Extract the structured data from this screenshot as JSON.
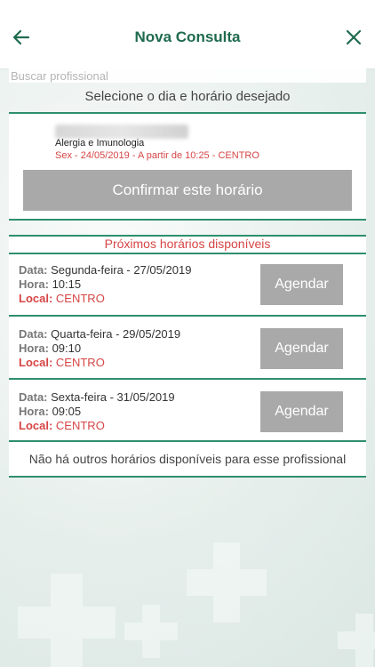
{
  "header": {
    "title": "Nova Consulta",
    "back_icon": "arrow-left-icon",
    "close_icon": "close-icon"
  },
  "search": {
    "placeholder": "Buscar profissional"
  },
  "instruction": "Selecione o dia e horário desejado",
  "selected": {
    "specialty": "Alergia e Imunologia",
    "detail": "Sex - 24/05/2019 - A partir de 10:25 - CENTRO",
    "confirm_label": "Confirmar este horário"
  },
  "next": {
    "title": "Próximos horários disponíveis",
    "date_label": "Data:",
    "time_label": "Hora:",
    "place_label": "Local:",
    "book_label": "Agendar",
    "slots": [
      {
        "date": "Segunda-feira - 27/05/2019",
        "time": "10:15",
        "place": "CENTRO"
      },
      {
        "date": "Quarta-feira - 29/05/2019",
        "time": "09:10",
        "place": "CENTRO"
      },
      {
        "date": "Sexta-feira - 31/05/2019",
        "time": "09:05",
        "place": "CENTRO"
      }
    ],
    "no_more": "Não há outros horários disponíveis para esse profissional"
  },
  "colors": {
    "brand": "#1f6b4e",
    "accent_line": "#2e8f6e",
    "alert": "#d64545",
    "button": "#a9a9a9"
  }
}
